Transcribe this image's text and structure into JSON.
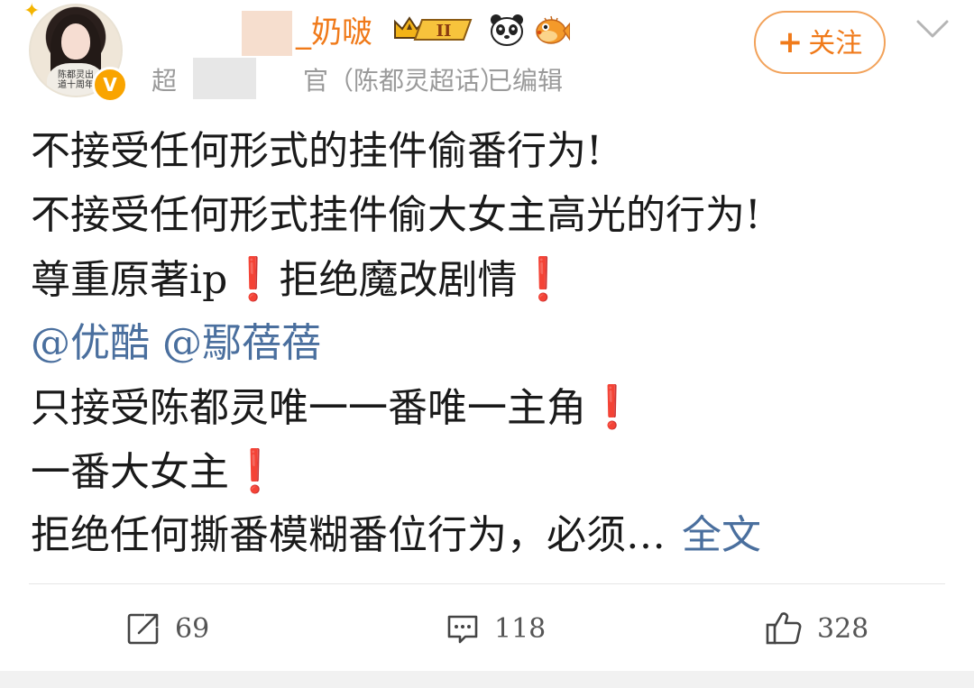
{
  "author": {
    "name": "_奶啵",
    "verified_mark": "V",
    "avatar_caption": "陈都灵出道十周年",
    "vip_badge_label": "II"
  },
  "meta": {
    "source_prefix": "超",
    "source_suffix": "官（陈都灵超话）",
    "edited_label": "已编辑"
  },
  "follow_button": {
    "plus": "+",
    "label": "关注"
  },
  "post": {
    "line1": "不接受任何形式的挂件偷番行为!",
    "line2": "不接受任何形式挂件偷大女主高光的行为!",
    "line3_a": "尊重原著ip",
    "line3_b": "拒绝魔改剧情",
    "mention1": "@优酷",
    "mention2": "@鄢蓓蓓",
    "line5": "只接受陈都灵唯一一番唯一主角",
    "line6": "一番大女主",
    "line7": "拒绝任何撕番模糊番位行为，必须…",
    "full_text_link": "全文",
    "exclamation": "❗"
  },
  "actions": {
    "repost_count": "69",
    "comment_count": "118",
    "like_count": "328"
  },
  "icons": {
    "repost": "share-arrow-icon",
    "comment": "comment-bubble-icon",
    "like": "thumbs-up-icon",
    "more": "chevron-down-icon",
    "vip": "crown-badge-icon",
    "panda": "panda-icon",
    "fish": "pufferfish-icon"
  },
  "colors": {
    "username": "#f07a1a",
    "link": "#4a6f9e",
    "exclamation": "#e6242c",
    "meta_text": "#9a9a9a"
  }
}
